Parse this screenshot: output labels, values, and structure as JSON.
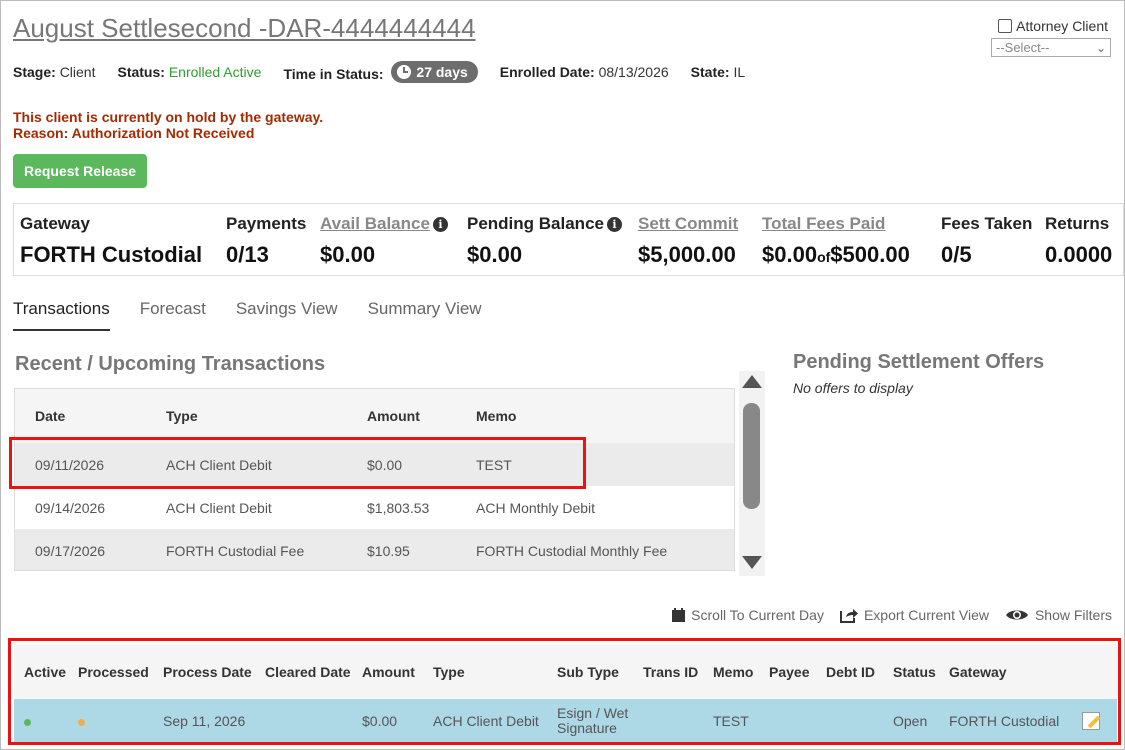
{
  "header": {
    "title": "August Settlesecond -DAR-4444444444",
    "attorney_client_label": "Attorney Client",
    "select_value": "--Select--"
  },
  "status_row": {
    "stage_label": "Stage:",
    "stage_value": "Client",
    "status_label": "Status:",
    "status_value": "Enrolled Active",
    "time_label": "Time in Status:",
    "time_value": "27 days",
    "enrolled_label": "Enrolled Date:",
    "enrolled_value": "08/13/2026",
    "state_label": "State:",
    "state_value": "IL"
  },
  "hold": {
    "line1": "This client is currently on hold by the gateway.",
    "line2": "Reason: Authorization Not Received"
  },
  "request_release_label": "Request Release",
  "summary": {
    "gateway_label": "Gateway",
    "gateway_value": "FORTH Custodial",
    "payments_label": "Payments",
    "payments_value": "0/13",
    "avail_label": "Avail Balance",
    "avail_value": "$0.00",
    "pending_label": "Pending Balance",
    "pending_value": "$0.00",
    "sett_label": "Sett Commit",
    "sett_value": "$5,000.00",
    "fees_paid_label": "Total Fees Paid",
    "fees_paid_value": "$0.00",
    "fees_paid_of": "of",
    "fees_paid_total": "$500.00",
    "fees_taken_label": "Fees Taken",
    "fees_taken_value": "0/5",
    "returns_label": "Returns",
    "returns_value": "0.0000"
  },
  "tabs": [
    {
      "label": "Transactions",
      "active": true
    },
    {
      "label": "Forecast"
    },
    {
      "label": "Savings View"
    },
    {
      "label": "Summary View"
    }
  ],
  "recent": {
    "title": "Recent / Upcoming Transactions",
    "columns": [
      "Date",
      "Type",
      "Amount",
      "Memo"
    ],
    "rows": [
      [
        "09/11/2026",
        "ACH Client Debit",
        "$0.00",
        "TEST"
      ],
      [
        "09/14/2026",
        "ACH Client Debit",
        "$1,803.53",
        "ACH Monthly Debit"
      ],
      [
        "09/17/2026",
        "FORTH Custodial Fee",
        "$10.95",
        "FORTH Custodial Monthly Fee"
      ]
    ]
  },
  "pending_offers": {
    "title": "Pending Settlement Offers",
    "empty": "No offers to display"
  },
  "toolbar": {
    "scroll_label": "Scroll To Current Day",
    "export_label": "Export Current View",
    "filters_label": "Show Filters"
  },
  "ledger": {
    "columns": [
      "Active",
      "Processed",
      "Process Date",
      "Cleared Date",
      "Amount",
      "Type",
      "Sub Type",
      "Trans ID",
      "Memo",
      "Payee",
      "Debt ID",
      "Status",
      "Gateway"
    ],
    "row": {
      "process_date": "Sep 11, 2026",
      "cleared_date": "",
      "amount": "$0.00",
      "type": "ACH Client Debit",
      "sub_type_line1": "Esign / Wet",
      "sub_type_line2": "Signature",
      "trans_id": "",
      "memo": "TEST",
      "payee": "",
      "debt_id": "",
      "status": "Open",
      "gateway": "FORTH Custodial"
    }
  },
  "colors": {
    "status_green": "#2e9e2e",
    "hold_red": "#a52a00",
    "button_green": "#5cb85c",
    "row_highlight": "#add8e6",
    "annotation_red": "#ee1111"
  }
}
